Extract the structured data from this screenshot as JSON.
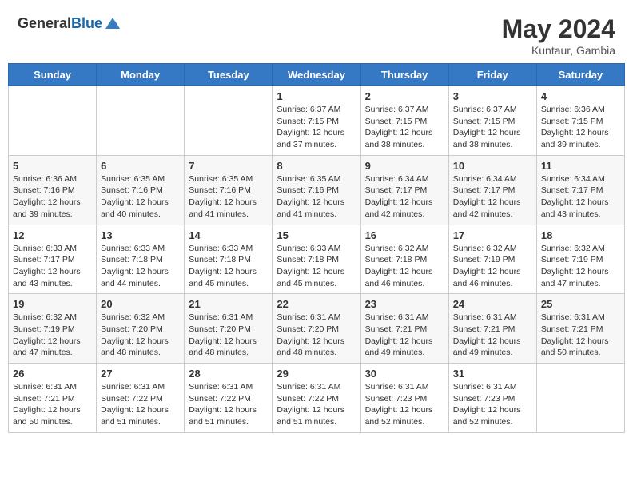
{
  "header": {
    "logo_general": "General",
    "logo_blue": "Blue",
    "month": "May 2024",
    "location": "Kuntaur, Gambia"
  },
  "days_of_week": [
    "Sunday",
    "Monday",
    "Tuesday",
    "Wednesday",
    "Thursday",
    "Friday",
    "Saturday"
  ],
  "weeks": [
    [
      {
        "day": "",
        "sunrise": "",
        "sunset": "",
        "daylight": ""
      },
      {
        "day": "",
        "sunrise": "",
        "sunset": "",
        "daylight": ""
      },
      {
        "day": "",
        "sunrise": "",
        "sunset": "",
        "daylight": ""
      },
      {
        "day": "1",
        "sunrise": "Sunrise: 6:37 AM",
        "sunset": "Sunset: 7:15 PM",
        "daylight": "Daylight: 12 hours and 37 minutes."
      },
      {
        "day": "2",
        "sunrise": "Sunrise: 6:37 AM",
        "sunset": "Sunset: 7:15 PM",
        "daylight": "Daylight: 12 hours and 38 minutes."
      },
      {
        "day": "3",
        "sunrise": "Sunrise: 6:37 AM",
        "sunset": "Sunset: 7:15 PM",
        "daylight": "Daylight: 12 hours and 38 minutes."
      },
      {
        "day": "4",
        "sunrise": "Sunrise: 6:36 AM",
        "sunset": "Sunset: 7:15 PM",
        "daylight": "Daylight: 12 hours and 39 minutes."
      }
    ],
    [
      {
        "day": "5",
        "sunrise": "Sunrise: 6:36 AM",
        "sunset": "Sunset: 7:16 PM",
        "daylight": "Daylight: 12 hours and 39 minutes."
      },
      {
        "day": "6",
        "sunrise": "Sunrise: 6:35 AM",
        "sunset": "Sunset: 7:16 PM",
        "daylight": "Daylight: 12 hours and 40 minutes."
      },
      {
        "day": "7",
        "sunrise": "Sunrise: 6:35 AM",
        "sunset": "Sunset: 7:16 PM",
        "daylight": "Daylight: 12 hours and 41 minutes."
      },
      {
        "day": "8",
        "sunrise": "Sunrise: 6:35 AM",
        "sunset": "Sunset: 7:16 PM",
        "daylight": "Daylight: 12 hours and 41 minutes."
      },
      {
        "day": "9",
        "sunrise": "Sunrise: 6:34 AM",
        "sunset": "Sunset: 7:17 PM",
        "daylight": "Daylight: 12 hours and 42 minutes."
      },
      {
        "day": "10",
        "sunrise": "Sunrise: 6:34 AM",
        "sunset": "Sunset: 7:17 PM",
        "daylight": "Daylight: 12 hours and 42 minutes."
      },
      {
        "day": "11",
        "sunrise": "Sunrise: 6:34 AM",
        "sunset": "Sunset: 7:17 PM",
        "daylight": "Daylight: 12 hours and 43 minutes."
      }
    ],
    [
      {
        "day": "12",
        "sunrise": "Sunrise: 6:33 AM",
        "sunset": "Sunset: 7:17 PM",
        "daylight": "Daylight: 12 hours and 43 minutes."
      },
      {
        "day": "13",
        "sunrise": "Sunrise: 6:33 AM",
        "sunset": "Sunset: 7:18 PM",
        "daylight": "Daylight: 12 hours and 44 minutes."
      },
      {
        "day": "14",
        "sunrise": "Sunrise: 6:33 AM",
        "sunset": "Sunset: 7:18 PM",
        "daylight": "Daylight: 12 hours and 45 minutes."
      },
      {
        "day": "15",
        "sunrise": "Sunrise: 6:33 AM",
        "sunset": "Sunset: 7:18 PM",
        "daylight": "Daylight: 12 hours and 45 minutes."
      },
      {
        "day": "16",
        "sunrise": "Sunrise: 6:32 AM",
        "sunset": "Sunset: 7:18 PM",
        "daylight": "Daylight: 12 hours and 46 minutes."
      },
      {
        "day": "17",
        "sunrise": "Sunrise: 6:32 AM",
        "sunset": "Sunset: 7:19 PM",
        "daylight": "Daylight: 12 hours and 46 minutes."
      },
      {
        "day": "18",
        "sunrise": "Sunrise: 6:32 AM",
        "sunset": "Sunset: 7:19 PM",
        "daylight": "Daylight: 12 hours and 47 minutes."
      }
    ],
    [
      {
        "day": "19",
        "sunrise": "Sunrise: 6:32 AM",
        "sunset": "Sunset: 7:19 PM",
        "daylight": "Daylight: 12 hours and 47 minutes."
      },
      {
        "day": "20",
        "sunrise": "Sunrise: 6:32 AM",
        "sunset": "Sunset: 7:20 PM",
        "daylight": "Daylight: 12 hours and 48 minutes."
      },
      {
        "day": "21",
        "sunrise": "Sunrise: 6:31 AM",
        "sunset": "Sunset: 7:20 PM",
        "daylight": "Daylight: 12 hours and 48 minutes."
      },
      {
        "day": "22",
        "sunrise": "Sunrise: 6:31 AM",
        "sunset": "Sunset: 7:20 PM",
        "daylight": "Daylight: 12 hours and 48 minutes."
      },
      {
        "day": "23",
        "sunrise": "Sunrise: 6:31 AM",
        "sunset": "Sunset: 7:21 PM",
        "daylight": "Daylight: 12 hours and 49 minutes."
      },
      {
        "day": "24",
        "sunrise": "Sunrise: 6:31 AM",
        "sunset": "Sunset: 7:21 PM",
        "daylight": "Daylight: 12 hours and 49 minutes."
      },
      {
        "day": "25",
        "sunrise": "Sunrise: 6:31 AM",
        "sunset": "Sunset: 7:21 PM",
        "daylight": "Daylight: 12 hours and 50 minutes."
      }
    ],
    [
      {
        "day": "26",
        "sunrise": "Sunrise: 6:31 AM",
        "sunset": "Sunset: 7:21 PM",
        "daylight": "Daylight: 12 hours and 50 minutes."
      },
      {
        "day": "27",
        "sunrise": "Sunrise: 6:31 AM",
        "sunset": "Sunset: 7:22 PM",
        "daylight": "Daylight: 12 hours and 51 minutes."
      },
      {
        "day": "28",
        "sunrise": "Sunrise: 6:31 AM",
        "sunset": "Sunset: 7:22 PM",
        "daylight": "Daylight: 12 hours and 51 minutes."
      },
      {
        "day": "29",
        "sunrise": "Sunrise: 6:31 AM",
        "sunset": "Sunset: 7:22 PM",
        "daylight": "Daylight: 12 hours and 51 minutes."
      },
      {
        "day": "30",
        "sunrise": "Sunrise: 6:31 AM",
        "sunset": "Sunset: 7:23 PM",
        "daylight": "Daylight: 12 hours and 52 minutes."
      },
      {
        "day": "31",
        "sunrise": "Sunrise: 6:31 AM",
        "sunset": "Sunset: 7:23 PM",
        "daylight": "Daylight: 12 hours and 52 minutes."
      },
      {
        "day": "",
        "sunrise": "",
        "sunset": "",
        "daylight": ""
      }
    ]
  ]
}
